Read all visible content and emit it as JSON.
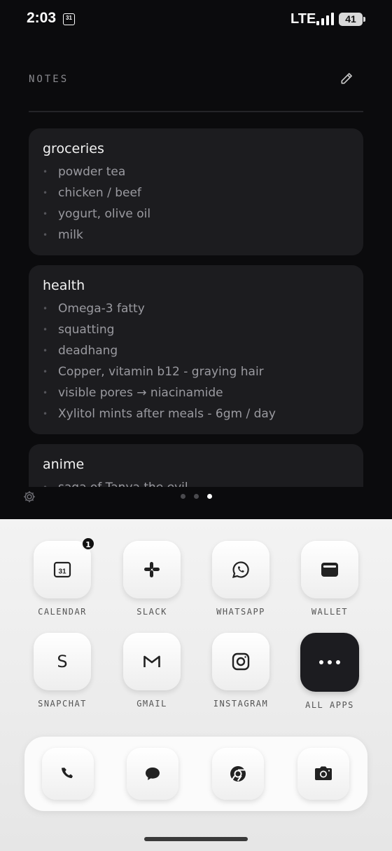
{
  "status_bar": {
    "time": "2:03",
    "calendar_date": "31",
    "network": "LTE",
    "battery": "41"
  },
  "notes": {
    "title": "NOTES",
    "cards": [
      {
        "title": "groceries",
        "items": [
          "powder tea",
          "chicken / beef",
          "yogurt, olive oil",
          "milk"
        ]
      },
      {
        "title": "health",
        "items": [
          "Omega-3 fatty",
          "squatting",
          "deadhang",
          "Copper, vitamin b12 - graying hair",
          "visible pores → niacinamide",
          "Xylitol mints after meals - 6gm / day"
        ]
      },
      {
        "title": "anime",
        "items": [
          "saga of Tanya the evil"
        ]
      }
    ]
  },
  "pager": {
    "count": 3,
    "active_index": 2
  },
  "apps": [
    {
      "label": "CALENDAR",
      "icon": "calendar-icon",
      "glyph": "31",
      "badge": "1"
    },
    {
      "label": "SLACK",
      "icon": "slack-icon"
    },
    {
      "label": "WHATSAPP",
      "icon": "whatsapp-icon"
    },
    {
      "label": "WALLET",
      "icon": "wallet-icon"
    },
    {
      "label": "SNAPCHAT",
      "icon": "snapchat-icon",
      "glyph": "S"
    },
    {
      "label": "GMAIL",
      "icon": "gmail-icon"
    },
    {
      "label": "INSTAGRAM",
      "icon": "instagram-icon"
    },
    {
      "label": "ALL APPS",
      "icon": "more-dots-icon"
    }
  ],
  "dock": [
    "phone-icon",
    "messages-icon",
    "chrome-icon",
    "camera-icon"
  ],
  "colors": {
    "background": "#0b0b0d",
    "card": "#1c1c1f",
    "launcher": "#f3f3f3",
    "accent_dark": "#1c1c20"
  }
}
